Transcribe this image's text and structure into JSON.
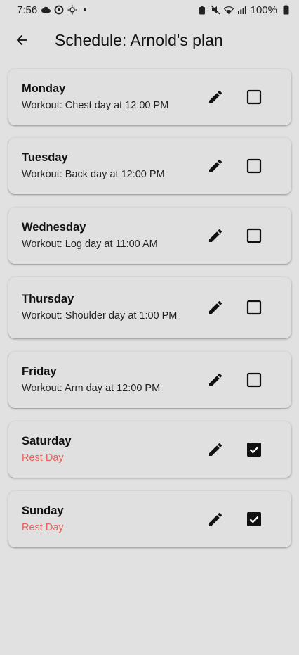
{
  "status_bar": {
    "time": "7:56",
    "battery": "100%"
  },
  "app_bar": {
    "title": "Schedule: Arnold's plan"
  },
  "schedule": [
    {
      "day": "Monday",
      "detail": "Workout: Chest day at 12:00 PM",
      "rest": false,
      "checked": false
    },
    {
      "day": "Tuesday",
      "detail": "Workout: Back day at 12:00 PM",
      "rest": false,
      "checked": false
    },
    {
      "day": "Wednesday",
      "detail": "Workout: Log day at 11:00 AM",
      "rest": false,
      "checked": false
    },
    {
      "day": "Thursday",
      "detail": "Workout: Shoulder day at 1:00 PM",
      "rest": false,
      "checked": false
    },
    {
      "day": "Friday",
      "detail": "Workout: Arm day at 12:00 PM",
      "rest": false,
      "checked": false
    },
    {
      "day": "Saturday",
      "detail": "Rest Day",
      "rest": true,
      "checked": true
    },
    {
      "day": "Sunday",
      "detail": "Rest Day",
      "rest": true,
      "checked": true
    }
  ],
  "colors": {
    "background": "#e1e1e1",
    "rest_text": "#e8615c",
    "text": "#111111"
  }
}
